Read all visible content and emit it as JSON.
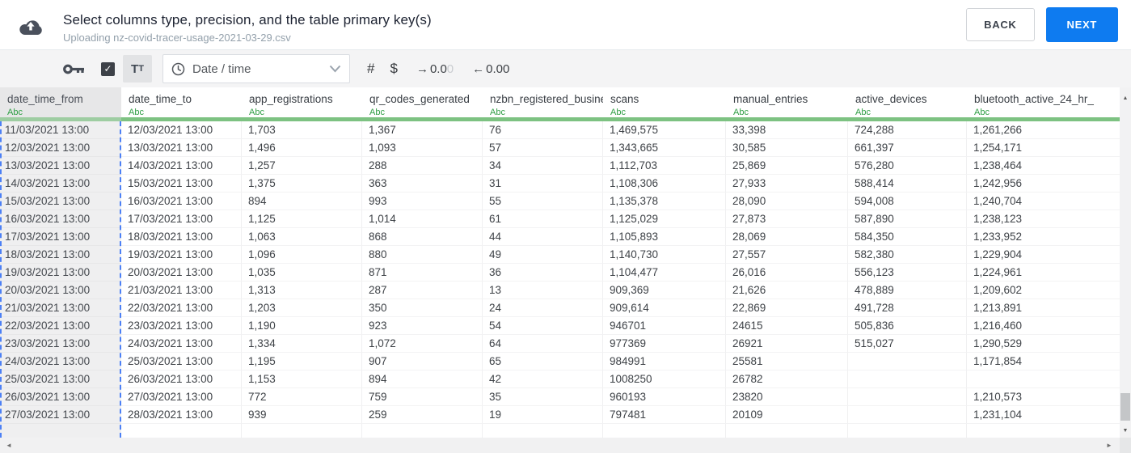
{
  "header": {
    "title": "Select columns type, precision, and the table primary key(s)",
    "subtitle": "Uploading nz-covid-tracer-usage-2021-03-29.csv",
    "back_label": "BACK",
    "next_label": "NEXT"
  },
  "toolbar": {
    "checkbox_checked": true,
    "text_format": {
      "first": "T",
      "second": "t"
    },
    "type_dropdown_value": "Date / time",
    "number_label": "#",
    "currency_label": "$",
    "decimal_increase": {
      "arrow": "→",
      "value": "0.0",
      "faded": "0"
    },
    "decimal_decrease": {
      "arrow": "←",
      "value": "0.00",
      "faded": ""
    }
  },
  "icons": {
    "check": "✓",
    "up_arrow": "▲",
    "down_arrow": "▼",
    "left_arrow": "◄",
    "right_arrow": "►"
  },
  "table": {
    "type_badge": "Abc",
    "columns": [
      {
        "name": "date_time_from",
        "selected": true
      },
      {
        "name": "date_time_to",
        "selected": false
      },
      {
        "name": "app_registrations",
        "selected": false
      },
      {
        "name": "qr_codes_generated",
        "selected": false
      },
      {
        "name": "nzbn_registered_busine",
        "selected": false
      },
      {
        "name": "scans",
        "selected": false
      },
      {
        "name": "manual_entries",
        "selected": false
      },
      {
        "name": "active_devices",
        "selected": false
      },
      {
        "name": "bluetooth_active_24_hr_",
        "selected": false
      }
    ],
    "rows": [
      [
        "11/03/2021 13:00",
        "12/03/2021 13:00",
        "1,703",
        "1,367",
        "76",
        "1,469,575",
        "33,398",
        "724,288",
        "1,261,266"
      ],
      [
        "12/03/2021 13:00",
        "13/03/2021 13:00",
        "1,496",
        "1,093",
        "57",
        "1,343,665",
        "30,585",
        "661,397",
        "1,254,171"
      ],
      [
        "13/03/2021 13:00",
        "14/03/2021 13:00",
        "1,257",
        "288",
        "34",
        "1,112,703",
        "25,869",
        "576,280",
        "1,238,464"
      ],
      [
        "14/03/2021 13:00",
        "15/03/2021 13:00",
        "1,375",
        "363",
        "31",
        "1,108,306",
        "27,933",
        "588,414",
        "1,242,956"
      ],
      [
        "15/03/2021 13:00",
        "16/03/2021 13:00",
        "894",
        "993",
        "55",
        "1,135,378",
        "28,090",
        "594,008",
        "1,240,704"
      ],
      [
        "16/03/2021 13:00",
        "17/03/2021 13:00",
        "1,125",
        "1,014",
        "61",
        "1,125,029",
        "27,873",
        "587,890",
        "1,238,123"
      ],
      [
        "17/03/2021 13:00",
        "18/03/2021 13:00",
        "1,063",
        "868",
        "44",
        "1,105,893",
        "28,069",
        "584,350",
        "1,233,952"
      ],
      [
        "18/03/2021 13:00",
        "19/03/2021 13:00",
        "1,096",
        "880",
        "49",
        "1,140,730",
        "27,557",
        "582,380",
        "1,229,904"
      ],
      [
        "19/03/2021 13:00",
        "20/03/2021 13:00",
        "1,035",
        "871",
        "36",
        "1,104,477",
        "26,016",
        "556,123",
        "1,224,961"
      ],
      [
        "20/03/2021 13:00",
        "21/03/2021 13:00",
        "1,313",
        "287",
        "13",
        "909,369",
        "21,626",
        "478,889",
        "1,209,602"
      ],
      [
        "21/03/2021 13:00",
        "22/03/2021 13:00",
        "1,203",
        "350",
        "24",
        "909,614",
        "22,869",
        "491,728",
        "1,213,891"
      ],
      [
        "22/03/2021 13:00",
        "23/03/2021 13:00",
        "1,190",
        "923",
        "54",
        "946701",
        "24615",
        "505,836",
        "1,216,460"
      ],
      [
        "23/03/2021 13:00",
        "24/03/2021 13:00",
        "1,334",
        "1,072",
        "64",
        "977369",
        "26921",
        "515,027",
        "1,290,529"
      ],
      [
        "24/03/2021 13:00",
        "25/03/2021 13:00",
        "1,195",
        "907",
        "65",
        "984991",
        "25581",
        "",
        "1,171,854"
      ],
      [
        "25/03/2021 13:00",
        "26/03/2021 13:00",
        "1,153",
        "894",
        "42",
        "1008250",
        "26782",
        "",
        ""
      ],
      [
        "26/03/2021 13:00",
        "27/03/2021 13:00",
        "772",
        "759",
        "35",
        "960193",
        "23820",
        "",
        "1,210,573"
      ],
      [
        "27/03/2021 13:00",
        "28/03/2021 13:00",
        "939",
        "259",
        "19",
        "797481",
        "20109",
        "",
        "1,231,104"
      ]
    ]
  },
  "colors": {
    "accent_blue": "#0e7bf0",
    "type_green": "#2f9e44",
    "bar_green": "#7dc282",
    "selection_dash_blue": "#4c80f5"
  }
}
